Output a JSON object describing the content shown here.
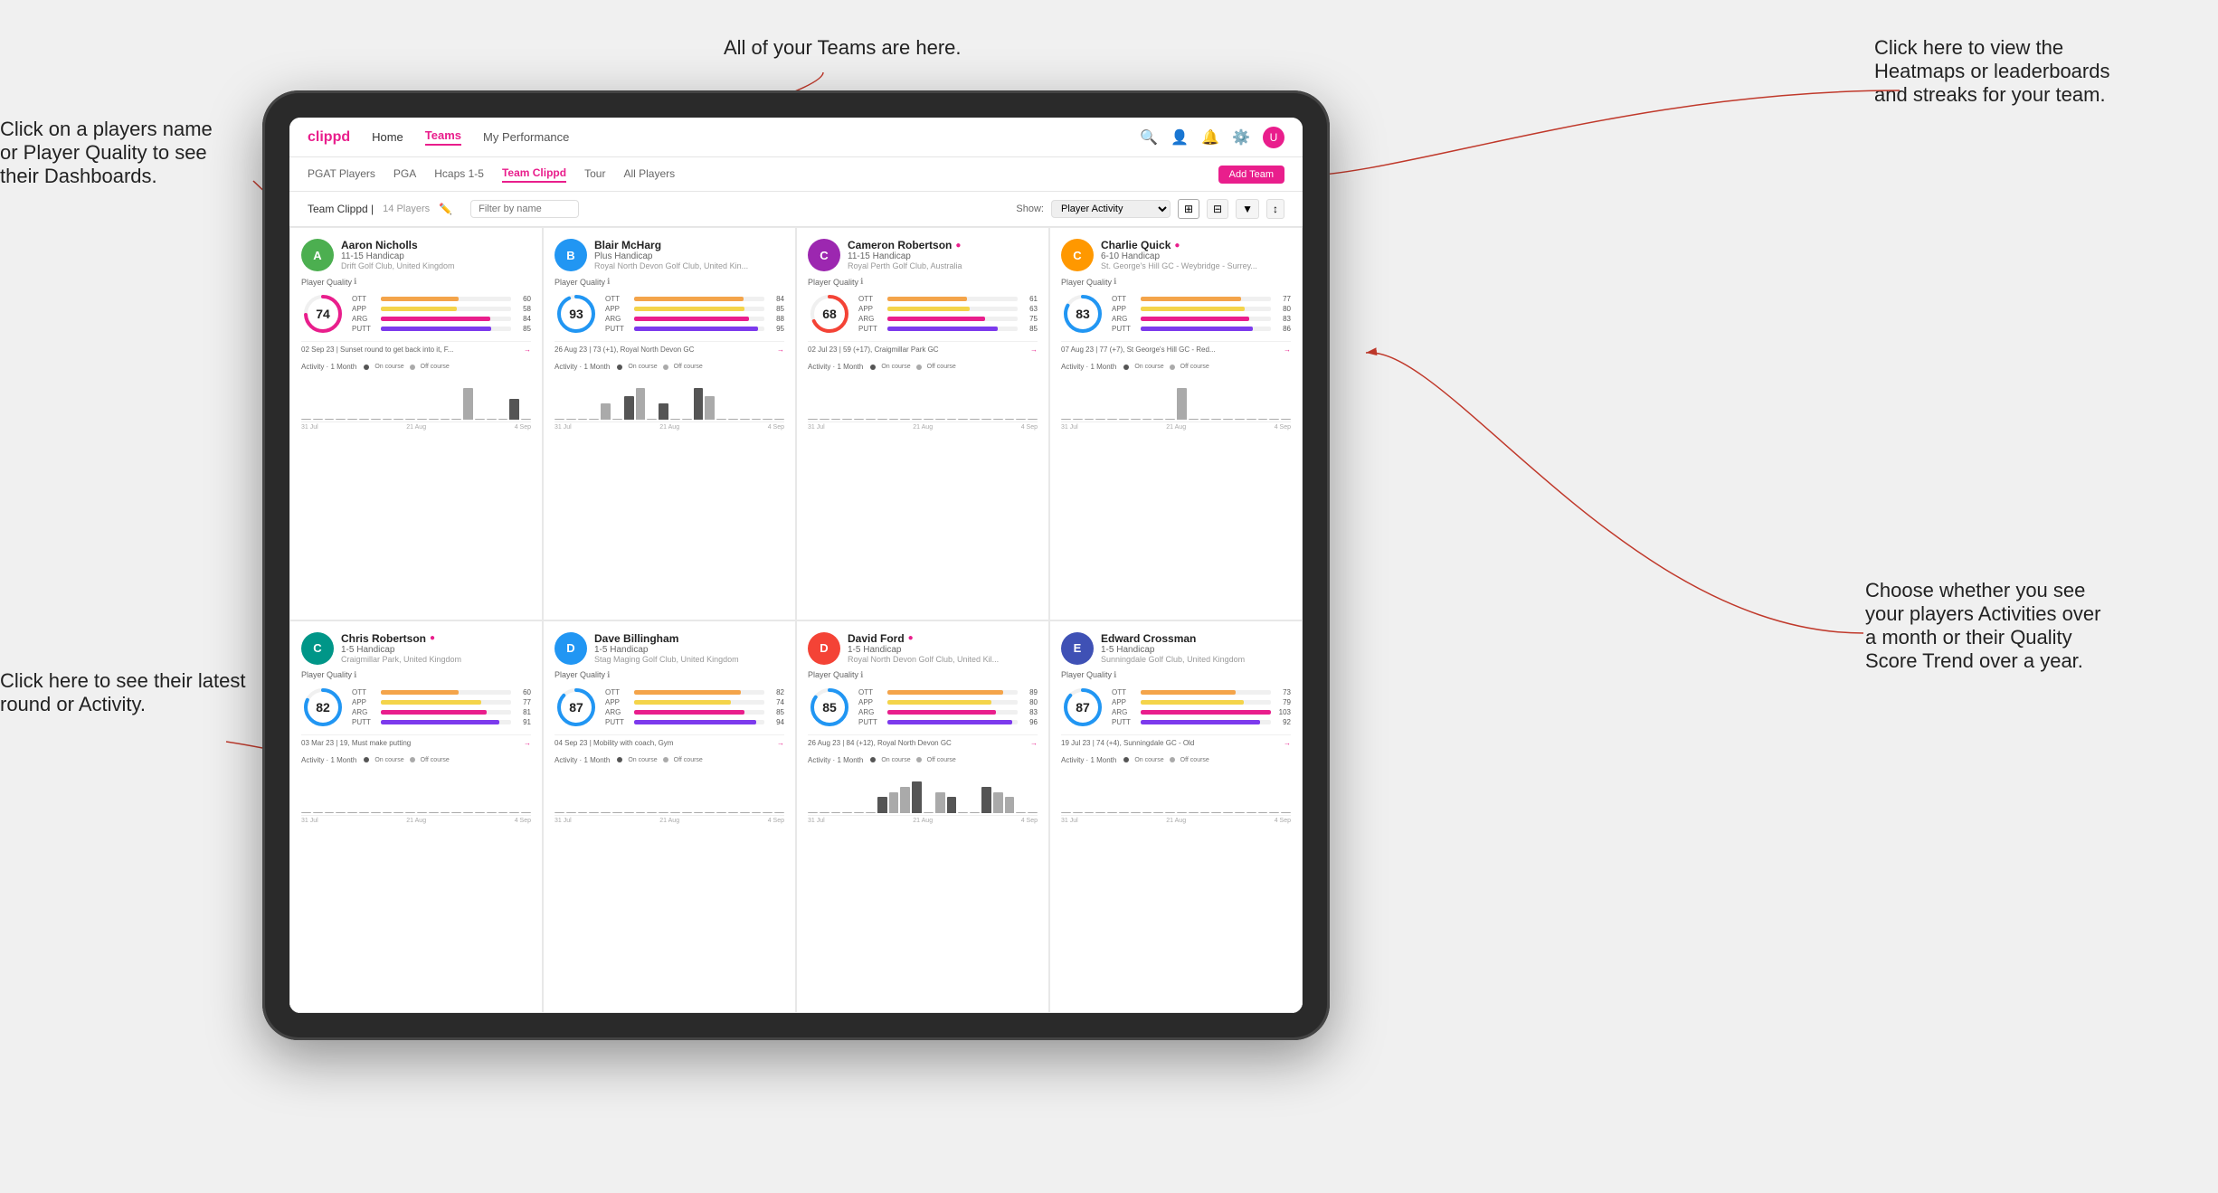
{
  "annotations": {
    "teams_callout": "All of your Teams are here.",
    "heatmaps_callout": "Click here to view the\nHeatmaps or leaderboards\nand streaks for your team.",
    "player_name_callout": "Click on a players name\nor Player Quality to see\ntheir Dashboards.",
    "latest_round_callout": "Click here to see their latest\nround or Activity.",
    "activities_callout": "Choose whether you see\nyour players Activities over\na month or their Quality\nScore Trend over a year."
  },
  "nav": {
    "logo": "clippd",
    "links": [
      "Home",
      "Teams",
      "My Performance"
    ],
    "icons": [
      "search",
      "person",
      "bell",
      "circle-arrow",
      "avatar"
    ]
  },
  "tabs": {
    "items": [
      "PGAT Players",
      "PGA",
      "Hcaps 1-5",
      "Team Clippd",
      "Tour",
      "All Players"
    ],
    "active": "Team Clippd",
    "add_button": "Add Team"
  },
  "team_header": {
    "title": "Team Clippd",
    "players_count": "14 Players",
    "filter_placeholder": "Filter by name",
    "show_label": "Show:",
    "show_option": "Player Activity",
    "view_icons": [
      "grid",
      "list",
      "filter",
      "sort"
    ]
  },
  "players": [
    {
      "name": "Aaron Nicholls",
      "handicap": "11-15 Handicap",
      "club": "Drift Golf Club, United Kingdom",
      "verified": false,
      "avatar_color": "green",
      "avatar_initial": "A",
      "quality": 74,
      "quality_color": "#e91e8c",
      "ott": {
        "value": 60,
        "pct": 60
      },
      "app": {
        "value": 58,
        "pct": 58
      },
      "arg": {
        "value": 84,
        "pct": 84
      },
      "putt": {
        "value": 85,
        "pct": 85
      },
      "last_round": "02 Sep 23 | Sunset round to get back into it, F...",
      "activity_bars": [
        0,
        0,
        0,
        0,
        0,
        0,
        0,
        0,
        0,
        0,
        0,
        0,
        0,
        0,
        3,
        0,
        0,
        0,
        2,
        0
      ],
      "chart_labels": [
        "31 Jul",
        "21 Aug",
        "4 Sep"
      ]
    },
    {
      "name": "Blair McHarg",
      "handicap": "Plus Handicap",
      "club": "Royal North Devon Golf Club, United Kin...",
      "verified": false,
      "avatar_color": "blue",
      "avatar_initial": "B",
      "quality": 93,
      "quality_color": "#2196f3",
      "ott": {
        "value": 84,
        "pct": 84
      },
      "app": {
        "value": 85,
        "pct": 85
      },
      "arg": {
        "value": 88,
        "pct": 88
      },
      "putt": {
        "value": 95,
        "pct": 95
      },
      "last_round": "26 Aug 23 | 73 (+1), Royal North Devon GC",
      "activity_bars": [
        0,
        0,
        0,
        0,
        2,
        0,
        3,
        4,
        0,
        2,
        0,
        0,
        4,
        3,
        0,
        0,
        0,
        0,
        0,
        0
      ],
      "chart_labels": [
        "31 Jul",
        "21 Aug",
        "4 Sep"
      ]
    },
    {
      "name": "Cameron Robertson",
      "handicap": "11-15 Handicap",
      "club": "Royal Perth Golf Club, Australia",
      "verified": true,
      "avatar_color": "purple",
      "avatar_initial": "C",
      "quality": 68,
      "quality_color": "#f44336",
      "ott": {
        "value": 61,
        "pct": 61
      },
      "app": {
        "value": 63,
        "pct": 63
      },
      "arg": {
        "value": 75,
        "pct": 75
      },
      "putt": {
        "value": 85,
        "pct": 85
      },
      "last_round": "02 Jul 23 | 59 (+17), Craigmillar Park GC",
      "activity_bars": [
        0,
        0,
        0,
        0,
        0,
        0,
        0,
        0,
        0,
        0,
        0,
        0,
        0,
        0,
        0,
        0,
        0,
        0,
        0,
        0
      ],
      "chart_labels": [
        "31 Jul",
        "21 Aug",
        "4 Sep"
      ]
    },
    {
      "name": "Charlie Quick",
      "handicap": "6-10 Handicap",
      "club": "St. George's Hill GC - Weybridge - Surrey...",
      "verified": true,
      "avatar_color": "orange",
      "avatar_initial": "C",
      "quality": 83,
      "quality_color": "#2196f3",
      "ott": {
        "value": 77,
        "pct": 77
      },
      "app": {
        "value": 80,
        "pct": 80
      },
      "arg": {
        "value": 83,
        "pct": 83
      },
      "putt": {
        "value": 86,
        "pct": 86
      },
      "last_round": "07 Aug 23 | 77 (+7), St George's Hill GC - Red...",
      "activity_bars": [
        0,
        0,
        0,
        0,
        0,
        0,
        0,
        0,
        0,
        0,
        3,
        0,
        0,
        0,
        0,
        0,
        0,
        0,
        0,
        0
      ],
      "chart_labels": [
        "31 Jul",
        "21 Aug",
        "4 Sep"
      ]
    },
    {
      "name": "Chris Robertson",
      "handicap": "1-5 Handicap",
      "club": "Craigmillar Park, United Kingdom",
      "verified": true,
      "avatar_color": "teal",
      "avatar_initial": "C",
      "quality": 82,
      "quality_color": "#2196f3",
      "ott": {
        "value": 60,
        "pct": 60
      },
      "app": {
        "value": 77,
        "pct": 77
      },
      "arg": {
        "value": 81,
        "pct": 81
      },
      "putt": {
        "value": 91,
        "pct": 91
      },
      "last_round": "03 Mar 23 | 19, Must make putting",
      "activity_bars": [
        0,
        0,
        0,
        0,
        0,
        0,
        0,
        0,
        0,
        0,
        0,
        0,
        0,
        0,
        0,
        0,
        0,
        0,
        0,
        0
      ],
      "chart_labels": [
        "31 Jul",
        "21 Aug",
        "4 Sep"
      ]
    },
    {
      "name": "Dave Billingham",
      "handicap": "1-5 Handicap",
      "club": "Stag Maging Golf Club, United Kingdom",
      "verified": false,
      "avatar_color": "blue",
      "avatar_initial": "D",
      "quality": 87,
      "quality_color": "#2196f3",
      "ott": {
        "value": 82,
        "pct": 82
      },
      "app": {
        "value": 74,
        "pct": 74
      },
      "arg": {
        "value": 85,
        "pct": 85
      },
      "putt": {
        "value": 94,
        "pct": 94
      },
      "last_round": "04 Sep 23 | Mobility with coach, Gym",
      "activity_bars": [
        0,
        0,
        0,
        0,
        0,
        0,
        0,
        0,
        0,
        0,
        0,
        0,
        0,
        0,
        0,
        0,
        0,
        0,
        0,
        0
      ],
      "chart_labels": [
        "31 Jul",
        "21 Aug",
        "4 Sep"
      ]
    },
    {
      "name": "David Ford",
      "handicap": "1-5 Handicap",
      "club": "Royal North Devon Golf Club, United Kil...",
      "verified": true,
      "avatar_color": "red",
      "avatar_initial": "D",
      "quality": 85,
      "quality_color": "#2196f3",
      "ott": {
        "value": 89,
        "pct": 89
      },
      "app": {
        "value": 80,
        "pct": 80
      },
      "arg": {
        "value": 83,
        "pct": 83
      },
      "putt": {
        "value": 96,
        "pct": 96
      },
      "last_round": "26 Aug 23 | 84 (+12), Royal North Devon GC",
      "activity_bars": [
        0,
        0,
        0,
        0,
        0,
        0,
        3,
        4,
        5,
        6,
        0,
        4,
        3,
        0,
        0,
        5,
        4,
        3,
        0,
        0
      ],
      "chart_labels": [
        "31 Jul",
        "21 Aug",
        "4 Sep"
      ]
    },
    {
      "name": "Edward Crossman",
      "handicap": "1-5 Handicap",
      "club": "Sunningdale Golf Club, United Kingdom",
      "verified": false,
      "avatar_color": "indigo",
      "avatar_initial": "E",
      "quality": 87,
      "quality_color": "#2196f3",
      "ott": {
        "value": 73,
        "pct": 73
      },
      "app": {
        "value": 79,
        "pct": 79
      },
      "arg": {
        "value": 103,
        "pct": 100
      },
      "putt": {
        "value": 92,
        "pct": 92
      },
      "last_round": "19 Jul 23 | 74 (+4), Sunningdale GC - Old",
      "activity_bars": [
        0,
        0,
        0,
        0,
        0,
        0,
        0,
        0,
        0,
        0,
        0,
        0,
        0,
        0,
        0,
        0,
        0,
        0,
        0,
        0
      ],
      "chart_labels": [
        "31 Jul",
        "21 Aug",
        "4 Sep"
      ]
    }
  ],
  "activity_legend": {
    "month_label": "Activity · 1 Month",
    "on_course_label": "On course",
    "off_course_label": "Off course"
  }
}
